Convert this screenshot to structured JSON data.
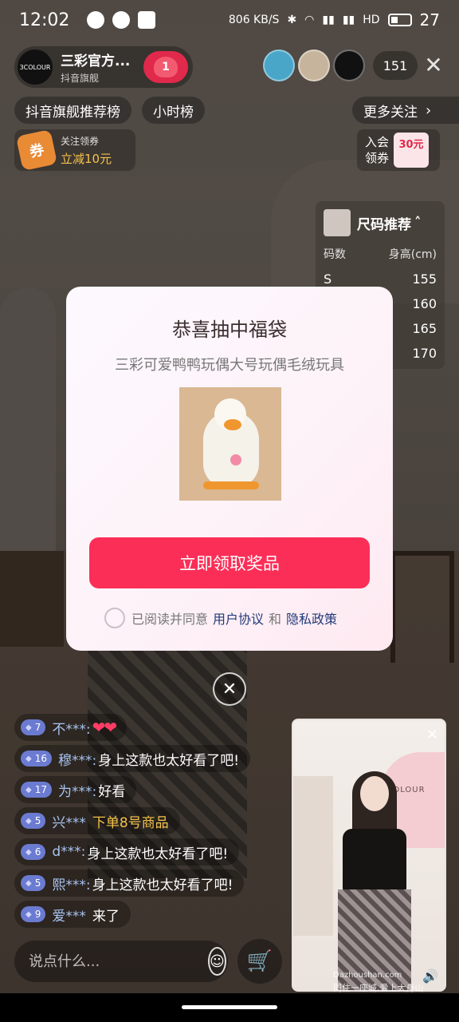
{
  "status_bar": {
    "time": "12:02",
    "speed": "806 KB/S",
    "network": "HD",
    "battery": "27"
  },
  "host": {
    "avatar_text": "3COLOUR",
    "name": "三彩官方...",
    "subtitle": "抖音旗舰",
    "follow_badge": "1"
  },
  "viewers": {
    "count": "151"
  },
  "top_chips": {
    "rank": "抖音旗舰推荐榜",
    "hour": "小时榜",
    "more_follow": "更多关注"
  },
  "coupon_left": {
    "icon_text": "券",
    "line1": "关注领券",
    "line2": "立减10元"
  },
  "coupon_right": {
    "line1": "入会",
    "line2": "领券",
    "amount": "30元"
  },
  "size_panel": {
    "title": "尺码推荐",
    "col_size": "码数",
    "col_height": "身高(cm)",
    "rows": [
      {
        "size": "S",
        "height": "155"
      },
      {
        "size": "",
        "height": "160"
      },
      {
        "size": "",
        "height": "165"
      },
      {
        "size": "",
        "height": "170"
      }
    ]
  },
  "background": {
    "brand": "3COLOUR"
  },
  "modal": {
    "title": "恭喜抽中福袋",
    "product_name": "三彩可爱鸭鸭玩偶大号玩偶毛绒玩具",
    "cta": "立即领取奖品",
    "agree_prefix": "已阅读并同意",
    "user_agreement": "用户协议",
    "and": "和",
    "privacy_policy": "隐私政策"
  },
  "comments": [
    {
      "level": "7",
      "user": "不***:",
      "text": "",
      "hearts": "❤❤",
      "style": "normal"
    },
    {
      "level": "16",
      "user": "穆***:",
      "text": "身上这款也太好看了吧!",
      "hearts": "",
      "style": "normal"
    },
    {
      "level": "17",
      "user": "为***:",
      "text": "好看",
      "hearts": "",
      "style": "normal"
    },
    {
      "level": "5",
      "user": "兴***",
      "text": "下单8号商品",
      "hearts": "",
      "style": "gold"
    },
    {
      "level": "6",
      "user": "d***:",
      "text": "身上这款也太好看了吧!",
      "hearts": "",
      "style": "normal"
    },
    {
      "level": "5",
      "user": "熙***:",
      "text": "身上这款也太好看了吧!",
      "hearts": "",
      "style": "normal"
    },
    {
      "level": "9",
      "user": "爱***",
      "text": "来了",
      "hearts": "",
      "style": "normal"
    }
  ],
  "input": {
    "placeholder": "说点什么..."
  },
  "miniplayer": {
    "brand": "3COLOUR"
  },
  "watermark": {
    "site": "Dazhoushan.com",
    "slogan": "同住一座城,爱上大舟山"
  }
}
